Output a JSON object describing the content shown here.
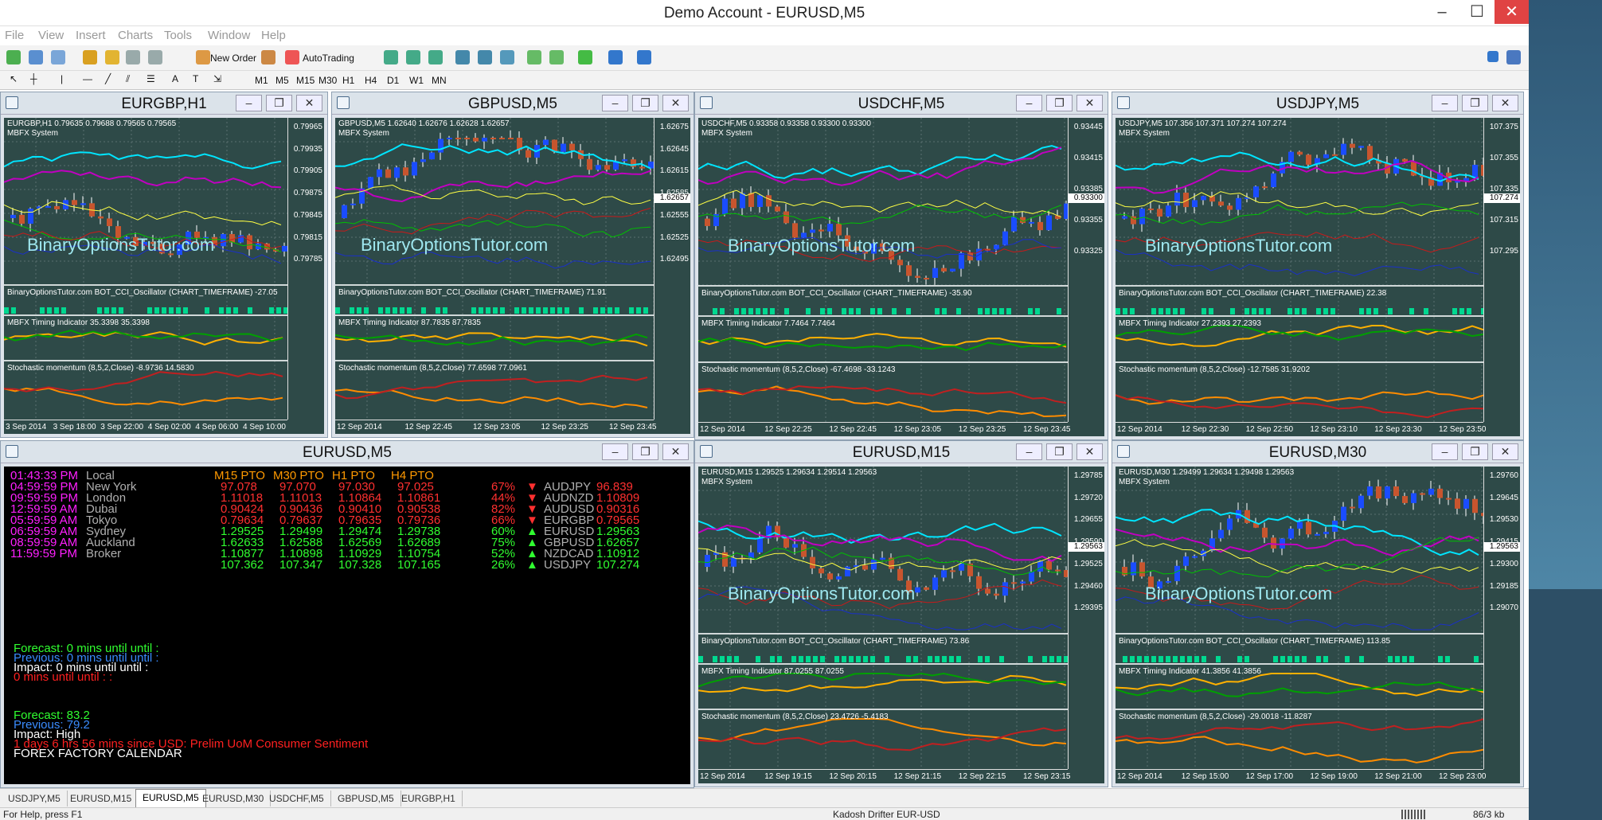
{
  "window": {
    "title_suffix": "Demo Account - EURUSD,M5"
  },
  "menu": [
    "File",
    "View",
    "Insert",
    "Charts",
    "Tools",
    "Window",
    "Help"
  ],
  "toolbar": {
    "new_order": "New Order",
    "autotrading": "AutoTrading",
    "timeframes": [
      "M1",
      "M5",
      "M15",
      "M30",
      "H1",
      "H4",
      "D1",
      "W1",
      "MN"
    ]
  },
  "charts": [
    {
      "title": "EURGBP,H1",
      "info": "EURGBP,H1  0.79635 0.79688 0.79565 0.79565",
      "system": "MBFX System",
      "watermark": "BinaryOptionsTutor.com",
      "cci": "BinaryOptionsTutor.com BOT_CCI_Oscillator (CHART_TIMEFRAME) -27.05",
      "timing": "MBFX Timing Indicator 35.3398 35.3398",
      "stoch": "Stochastic momentum (8,5,2,Close) -8.9736 14.5830",
      "price_labels": [
        "0.79965",
        "0.79935",
        "0.79905",
        "0.79875",
        "0.79845",
        "0.79815",
        "0.79785"
      ],
      "times": [
        "3 Sep 2014",
        "3 Sep 18:00",
        "3 Sep 22:00",
        "4 Sep 02:00",
        "4 Sep 06:00",
        "4 Sep 10:00"
      ],
      "cur": ""
    },
    {
      "title": "GBPUSD,M5",
      "info": "GBPUSD,M5  1.62640 1.62676 1.62628 1.62657",
      "system": "MBFX System",
      "watermark": "BinaryOptionsTutor.com",
      "cci": "BinaryOptionsTutor.com BOT_CCI_Oscillator (CHART_TIMEFRAME) 71.91",
      "timing": "MBFX Timing Indicator 87.7835 87.7835",
      "stoch": "Stochastic momentum (8,5,2,Close) 77.6598 77.0961",
      "price_labels": [
        "1.62675",
        "1.62645",
        "1.62615",
        "1.62585",
        "1.62555",
        "1.62525",
        "1.62495"
      ],
      "times": [
        "12 Sep 2014",
        "12 Sep 22:45",
        "12 Sep 23:05",
        "12 Sep 23:25",
        "12 Sep 23:45"
      ],
      "cur": "1.62657"
    },
    {
      "title": "USDCHF,M5",
      "info": "USDCHF,M5  0.93358 0.93358 0.93300 0.93300",
      "system": "MBFX System",
      "watermark": "BinaryOptionsTutor.com",
      "cci": "BinaryOptionsTutor.com BOT_CCI_Oscillator (CHART_TIMEFRAME) -35.90",
      "timing": "MBFX Timing Indicator 7.7464 7.7464",
      "stoch": "Stochastic momentum (8,5,2,Close) -67.4698 -33.1243",
      "price_labels": [
        "0.93445",
        "0.93415",
        "0.93385",
        "0.93355",
        "0.93325"
      ],
      "times": [
        "12 Sep 2014",
        "12 Sep 22:25",
        "12 Sep 22:45",
        "12 Sep 23:05",
        "12 Sep 23:25",
        "12 Sep 23:45"
      ],
      "cur": "0.93300"
    },
    {
      "title": "USDJPY,M5",
      "info": "USDJPY,M5  107.356 107.371 107.274 107.274",
      "system": "MBFX System",
      "watermark": "BinaryOptionsTutor.com",
      "cci": "BinaryOptionsTutor.com BOT_CCI_Oscillator (CHART_TIMEFRAME) 22.38",
      "timing": "MBFX Timing Indicator 27.2393 27.2393",
      "stoch": "Stochastic momentum (8,5,2,Close) -12.7585 31.9202",
      "price_labels": [
        "107.375",
        "107.355",
        "107.335",
        "107.315",
        "107.295"
      ],
      "times": [
        "12 Sep 2014",
        "12 Sep 22:30",
        "12 Sep 22:50",
        "12 Sep 23:10",
        "12 Sep 23:30",
        "12 Sep 23:50"
      ],
      "cur": "107.274"
    },
    {
      "title": "EURUSD,M15",
      "info": "EURUSD,M15  1.29525 1.29634 1.29514 1.29563",
      "system": "MBFX System",
      "watermark": "BinaryOptionsTutor.com",
      "cci": "BinaryOptionsTutor.com BOT_CCI_Oscillator (CHART_TIMEFRAME) 73.86",
      "timing": "MBFX Timing Indicator 87.0255 87.0255",
      "stoch": "Stochastic momentum (8,5,2,Close) 23.4726 -5.4183",
      "price_labels": [
        "1.29785",
        "1.29720",
        "1.29655",
        "1.29590",
        "1.29525",
        "1.29460",
        "1.29395"
      ],
      "times": [
        "12 Sep 2014",
        "12 Sep 19:15",
        "12 Sep 20:15",
        "12 Sep 21:15",
        "12 Sep 22:15",
        "12 Sep 23:15"
      ],
      "cur": "1.29563"
    },
    {
      "title": "EURUSD,M30",
      "info": "EURUSD,M30  1.29499 1.29634 1.29498 1.29563",
      "system": "MBFX System",
      "watermark": "BinaryOptionsTutor.com",
      "cci": "BinaryOptionsTutor.com BOT_CCI_Oscillator (CHART_TIMEFRAME) 113.85",
      "timing": "MBFX Timing Indicator 41.3856 41.3856",
      "stoch": "Stochastic momentum (8,5,2,Close) -29.0018 -11.8287",
      "price_labels": [
        "1.29760",
        "1.29645",
        "1.29530",
        "1.29415",
        "1.29300",
        "1.29185",
        "1.29070"
      ],
      "times": [
        "12 Sep 2014",
        "12 Sep 15:00",
        "12 Sep 17:00",
        "12 Sep 19:00",
        "12 Sep 21:00",
        "12 Sep 23:00"
      ],
      "cur": "1.29563"
    }
  ],
  "info_window": {
    "title": "EURUSD,M5",
    "clocks": [
      [
        "01:43:33 PM",
        "Local"
      ],
      [
        "04:59:59 PM",
        "New York"
      ],
      [
        "09:59:59 PM",
        "London"
      ],
      [
        "12:59:59 AM",
        "Dubai"
      ],
      [
        "05:59:59 AM",
        "Tokyo"
      ],
      [
        "06:59:59 AM",
        "Sydney"
      ],
      [
        "08:59:59 AM",
        "Auckland"
      ],
      [
        "11:59:59 PM",
        "Broker"
      ]
    ],
    "headers": [
      "M15 PTO",
      "M30 PTO",
      "H1 PTO",
      "H4 PTO"
    ],
    "rows": [
      [
        "97.078",
        "97.070",
        "97.030",
        "97.025"
      ],
      [
        "1.11018",
        "1.11013",
        "1.10864",
        "1.10861"
      ],
      [
        "0.90424",
        "0.90436",
        "0.90410",
        "0.90538"
      ],
      [
        "0.79634",
        "0.79637",
        "0.79635",
        "0.79736"
      ],
      [
        "1.29525",
        "1.29499",
        "1.29474",
        "1.29738"
      ],
      [
        "1.62633",
        "1.62588",
        "1.62569",
        "1.62689"
      ],
      [
        "1.10877",
        "1.10898",
        "1.10929",
        "1.10754"
      ],
      [
        "107.362",
        "107.347",
        "107.328",
        "107.165"
      ]
    ],
    "pcts": [
      "67%",
      "44%",
      "82%",
      "66%",
      "60%",
      "75%",
      "52%",
      "26%"
    ],
    "pairs": [
      [
        "AUDJPY",
        "96.839"
      ],
      [
        "AUDNZD",
        "1.10809"
      ],
      [
        "AUDUSD",
        "0.90316"
      ],
      [
        "EURGBP",
        "0.79565"
      ],
      [
        "EURUSD",
        "1.29563"
      ],
      [
        "GBPUSD",
        "1.62657"
      ],
      [
        "NZDCAD",
        "1.10912"
      ],
      [
        "USDJPY",
        "107.274"
      ]
    ],
    "forecast1": "Forecast: 0 mins until until :",
    "previous1": "Previous: 0 mins until until :",
    "impact1": "Impact: 0 mins until until :",
    "zero": "0 mins until until : :",
    "forecast2": "Forecast: 83.2",
    "previous2": "Previous: 79.2",
    "impact2": "Impact: High",
    "event": "1 days 6 hrs 56 mins since USD: Prelim UoM Consumer Sentiment",
    "ff": "FOREX FACTORY CALENDAR"
  },
  "tabs": [
    "USDJPY,M5",
    "EURUSD,M15",
    "EURUSD,M5",
    "EURUSD,M30",
    "USDCHF,M5",
    "GBPUSD,M5",
    "EURGBP,H1"
  ],
  "status": {
    "help": "For Help, press F1",
    "profile": "Kadosh Drifter EUR-USD",
    "traffic": "86/3 kb"
  }
}
